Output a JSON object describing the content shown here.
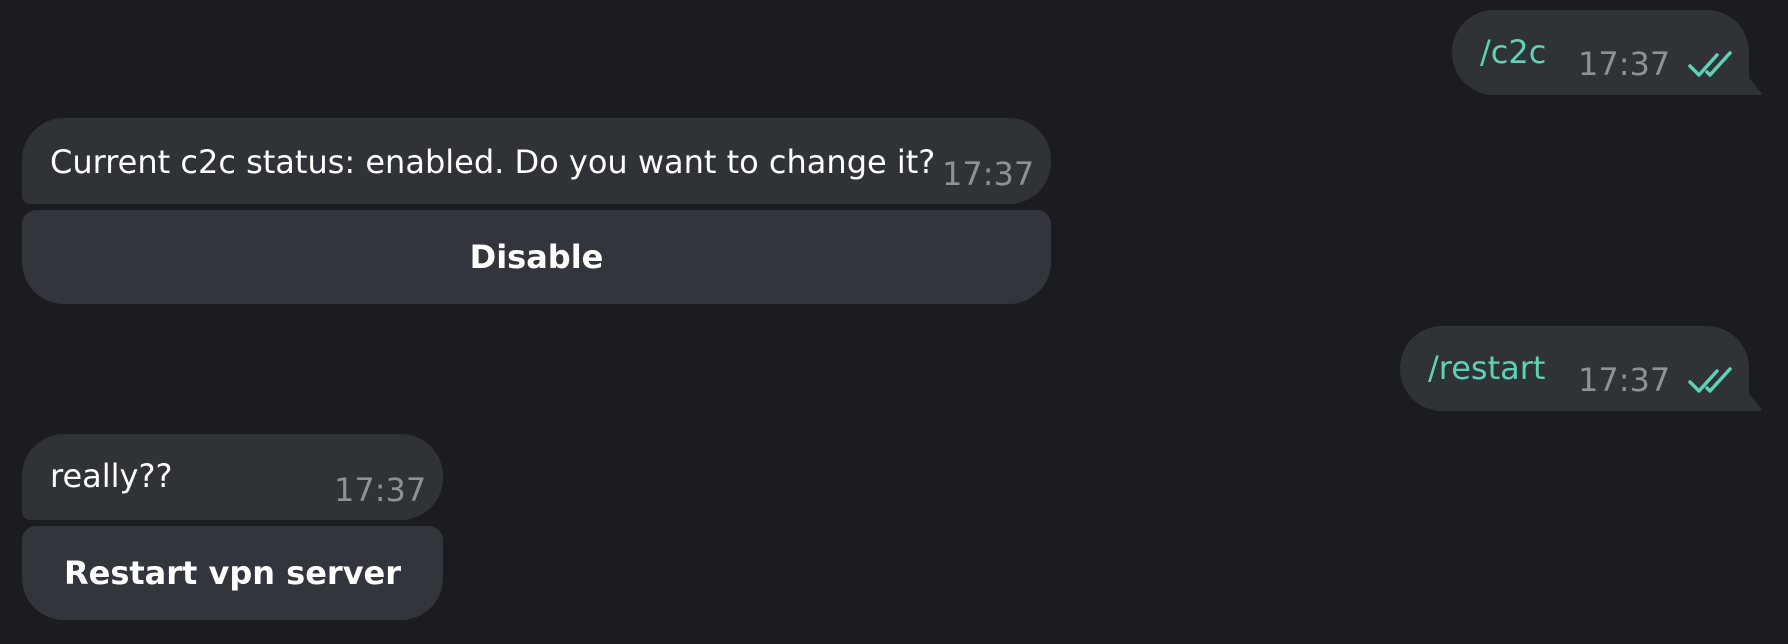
{
  "colors": {
    "background": "#1b1c20",
    "bubble": "#2f3236",
    "button": "#32353c",
    "accent": "#5fd1b5",
    "timestamp": "#8e9296"
  },
  "messages": [
    {
      "direction": "outgoing",
      "text": "/c2c",
      "time": "17:37",
      "status_icon": "double-check-icon"
    },
    {
      "direction": "incoming",
      "text": "Current c2c status: enabled. Do you want to change it?",
      "time": "17:37",
      "buttons": [
        "Disable"
      ]
    },
    {
      "direction": "outgoing",
      "text": "/restart",
      "time": "17:37",
      "status_icon": "double-check-icon"
    },
    {
      "direction": "incoming",
      "text": "really??",
      "time": "17:37",
      "buttons": [
        "Restart vpn server"
      ]
    }
  ]
}
